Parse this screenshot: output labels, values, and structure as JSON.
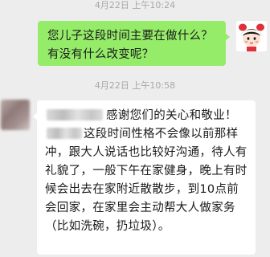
{
  "chat": {
    "timestamp_1": "4月22日 上午10:24",
    "timestamp_2": "4月22日 上午10:58",
    "outgoing_message": "您儿子这段时间主要在做什么？有没有什么改变呢？",
    "incoming_message": {
      "part_1": "感谢您们的关心和敬业！",
      "part_2": "这段时间性格不会像以前那样冲，跟大人说话也比较好沟通，待人有礼貌了，一般下午在家健身，晚上有时候会出去在家附近散散步，到10点前会回家，在家里会主动帮大人做家务（比如洗碗，扔垃圾）。"
    }
  },
  "colors": {
    "background": "#ededed",
    "outgoing_bubble": "#95ec69",
    "incoming_bubble": "#ffffff",
    "timestamp_text": "#a8a8a8"
  },
  "icons": {
    "self_avatar": "cartoon-girl-avatar-icon",
    "other_avatar": "blurred-avatar"
  }
}
